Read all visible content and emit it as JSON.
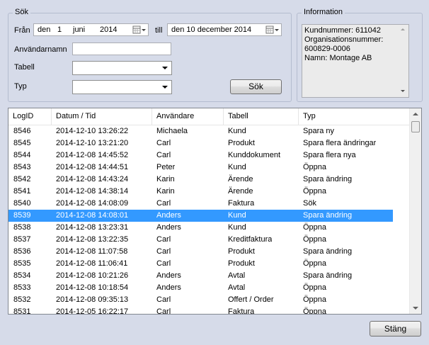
{
  "search": {
    "group_title": "Sök",
    "from_label": "Från",
    "from_date": {
      "prefix": "den",
      "day": "1",
      "month": "juni",
      "year": "2014"
    },
    "to_label": "till",
    "to_date_text": "den 10 december 2014",
    "username_label": "Användarnamn",
    "username_value": "",
    "table_label": "Tabell",
    "table_value": "",
    "type_label": "Typ",
    "type_value": "",
    "search_button": "Sök"
  },
  "information": {
    "group_title": "Information",
    "lines": [
      "Kundnummer: 611042",
      "Organisationsnummer:",
      "600829-0006",
      "Namn: Montage AB"
    ]
  },
  "log_list": {
    "columns": [
      "LogID",
      "Datum / Tid",
      "Användare",
      "Tabell",
      "Typ"
    ],
    "selected_index": 7,
    "rows": [
      [
        "8546",
        "2014-12-10 13:26:22",
        "Michaela",
        "Kund",
        "Spara ny"
      ],
      [
        "8545",
        "2014-12-10 13:21:20",
        "Carl",
        "Produkt",
        "Spara flera ändringar"
      ],
      [
        "8544",
        "2014-12-08 14:45:52",
        "Carl",
        "Kunddokument",
        "Spara flera nya"
      ],
      [
        "8543",
        "2014-12-08 14:44:51",
        "Peter",
        "Kund",
        "Öppna"
      ],
      [
        "8542",
        "2014-12-08 14:43:24",
        "Karin",
        "Ärende",
        "Spara ändring"
      ],
      [
        "8541",
        "2014-12-08 14:38:14",
        "Karin",
        "Ärende",
        "Öppna"
      ],
      [
        "8540",
        "2014-12-08 14:08:09",
        "Carl",
        "Faktura",
        "Sök"
      ],
      [
        "8539",
        "2014-12-08 14:08:01",
        "Anders",
        "Kund",
        "Spara ändring"
      ],
      [
        "8538",
        "2014-12-08 13:23:31",
        "Anders",
        "Kund",
        "Öppna"
      ],
      [
        "8537",
        "2014-12-08 13:22:35",
        "Carl",
        "Kreditfaktura",
        "Öppna"
      ],
      [
        "8536",
        "2014-12-08 11:07:58",
        "Carl",
        "Produkt",
        "Spara ändring"
      ],
      [
        "8535",
        "2014-12-08 11:06:41",
        "Carl",
        "Produkt",
        "Öppna"
      ],
      [
        "8534",
        "2014-12-08 10:21:26",
        "Anders",
        "Avtal",
        "Spara ändring"
      ],
      [
        "8533",
        "2014-12-08 10:18:54",
        "Anders",
        "Avtal",
        "Öppna"
      ],
      [
        "8532",
        "2014-12-08 09:35:13",
        "Carl",
        "Offert / Order",
        "Öppna"
      ],
      [
        "8531",
        "2014-12-05 16:22:17",
        "Carl",
        "Faktura",
        "Öppna"
      ]
    ]
  },
  "footer": {
    "close_button": "Stäng"
  },
  "colors": {
    "background": "#d6dbe9",
    "selection": "#3399ff"
  }
}
